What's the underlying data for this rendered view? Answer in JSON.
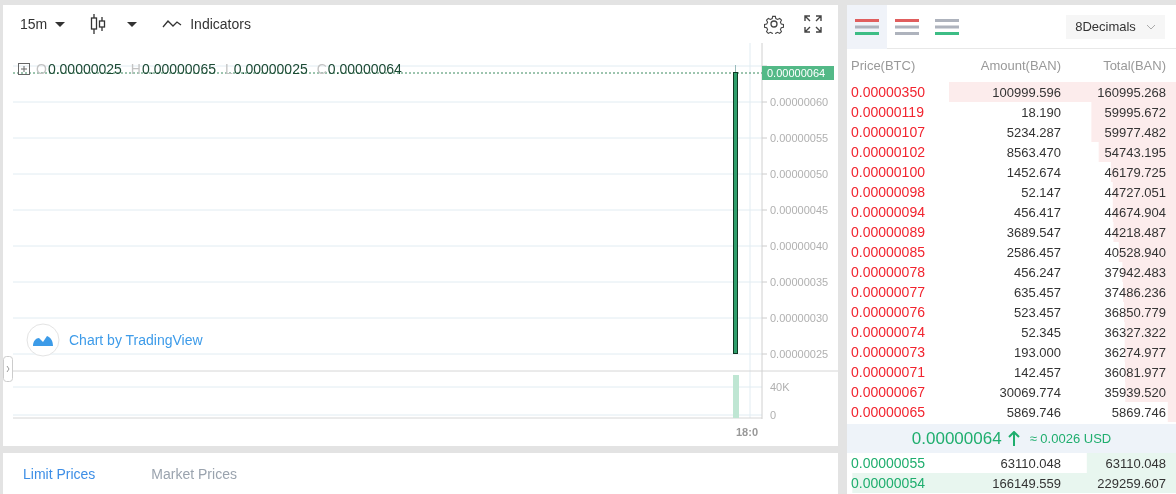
{
  "chart_toolbar": {
    "interval": "15m",
    "indicators": "Indicators"
  },
  "legend": [
    {
      "label": "O",
      "value": "0.00000025"
    },
    {
      "label": "H",
      "value": "0.00000065"
    },
    {
      "label": "L",
      "value": "0.00000025"
    },
    {
      "label": "C",
      "value": "0.00000064"
    }
  ],
  "price_axis": [
    "0.00000060",
    "0.00000055",
    "0.00000050",
    "0.00000045",
    "0.00000040",
    "0.00000035",
    "0.00000030",
    "0.00000025"
  ],
  "last_price_tag": "0.00000064",
  "volume_axis": [
    "40K",
    "0"
  ],
  "time_axis": [
    "18:0"
  ],
  "attribution": "Chart by TradingView",
  "bottom_tabs": [
    {
      "label": "Limit Prices",
      "selected": true
    },
    {
      "label": "Market Prices",
      "selected": false
    }
  ],
  "order_book": {
    "view_modes": [
      {
        "kind": "both",
        "selected": true
      },
      {
        "kind": "asks",
        "selected": false
      },
      {
        "kind": "bids",
        "selected": false
      }
    ],
    "decimals": "8Decimals",
    "columns": [
      "Price(BTC)",
      "Amount(BAN)",
      "Total(BAN)"
    ],
    "asks": [
      {
        "price": "0.00000350",
        "amount": "100999.596",
        "total": "160995.268",
        "level": 0.69
      },
      {
        "price": "0.00000119",
        "amount": "18.190",
        "total": "59995.672",
        "level": 0.257
      },
      {
        "price": "0.00000107",
        "amount": "5234.287",
        "total": "59977.482",
        "level": 0.257
      },
      {
        "price": "0.00000102",
        "amount": "8563.470",
        "total": "54743.195",
        "level": 0.235
      },
      {
        "price": "0.00000100",
        "amount": "1452.674",
        "total": "46179.725",
        "level": 0.198
      },
      {
        "price": "0.00000098",
        "amount": "52.147",
        "total": "44727.051",
        "level": 0.192
      },
      {
        "price": "0.00000094",
        "amount": "456.417",
        "total": "44674.904",
        "level": 0.192
      },
      {
        "price": "0.00000089",
        "amount": "3689.547",
        "total": "44218.487",
        "level": 0.19
      },
      {
        "price": "0.00000085",
        "amount": "2586.457",
        "total": "40528.940",
        "level": 0.174
      },
      {
        "price": "0.00000078",
        "amount": "456.247",
        "total": "37942.483",
        "level": 0.163
      },
      {
        "price": "0.00000077",
        "amount": "635.457",
        "total": "37486.236",
        "level": 0.161
      },
      {
        "price": "0.00000076",
        "amount": "523.457",
        "total": "36850.779",
        "level": 0.158
      },
      {
        "price": "0.00000074",
        "amount": "52.345",
        "total": "36327.322",
        "level": 0.156
      },
      {
        "price": "0.00000073",
        "amount": "193.000",
        "total": "36274.977",
        "level": 0.156
      },
      {
        "price": "0.00000071",
        "amount": "142.457",
        "total": "36081.977",
        "level": 0.155
      },
      {
        "price": "0.00000067",
        "amount": "30069.774",
        "total": "35939.520",
        "level": 0.154
      },
      {
        "price": "0.00000065",
        "amount": "5869.746",
        "total": "5869.746",
        "level": 0.025
      }
    ],
    "last_price": {
      "price": "0.00000064",
      "rising": true,
      "usd": "≈ 0.0026 USD"
    },
    "bids": [
      {
        "price": "0.00000055",
        "amount": "63110.048",
        "total": "63110.048",
        "level": 0.271
      },
      {
        "price": "0.00000054",
        "amount": "166149.559",
        "total": "229259.607",
        "level": 0.984
      }
    ]
  }
}
